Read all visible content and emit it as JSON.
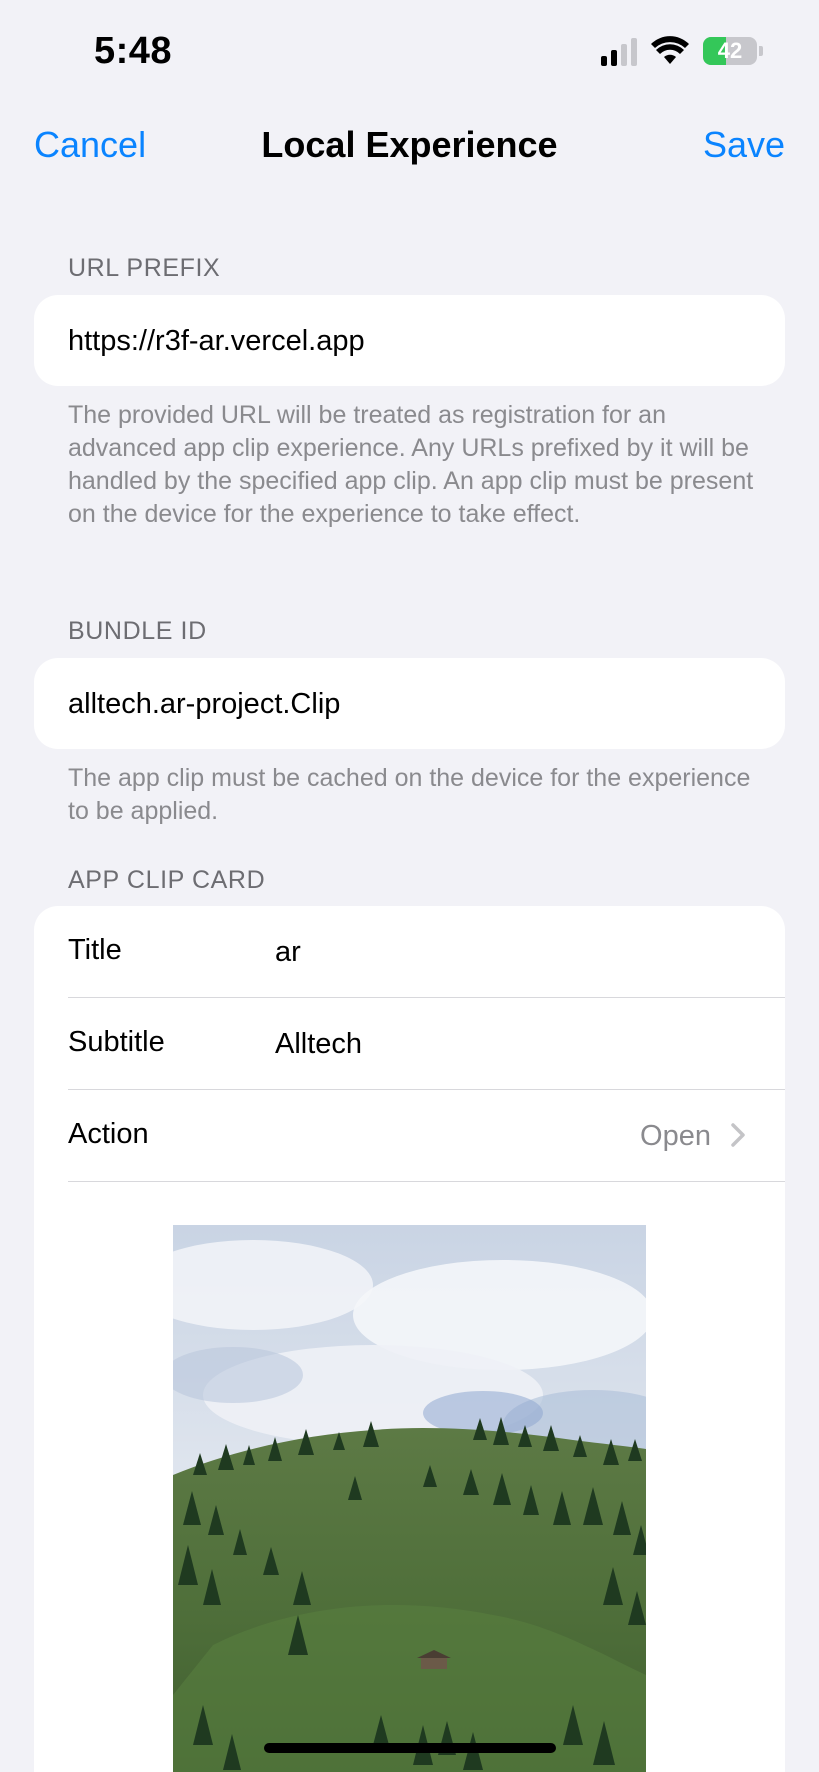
{
  "status_bar": {
    "time": "5:48",
    "battery_percent": "42",
    "battery_level": 0.42,
    "signal_bars_active": 2,
    "icons": [
      "signal-icon",
      "wifi-icon",
      "battery-charging-icon"
    ]
  },
  "nav": {
    "cancel_label": "Cancel",
    "title": "Local Experience",
    "save_label": "Save"
  },
  "url_prefix": {
    "header": "URL PREFIX",
    "value": "https://r3f-ar.vercel.app",
    "footer": "The provided URL will be treated as registration for an advanced app clip experience. Any URLs prefixed by it will be handled by the specified app clip. An app clip must be present on the device for the experience to take effect."
  },
  "bundle_id": {
    "header": "BUNDLE ID",
    "value": "alltech.ar-project.Clip",
    "footer": "The app clip must be cached on the device for the experience to be applied."
  },
  "app_clip_card": {
    "header": "APP CLIP CARD",
    "rows": [
      {
        "label": "Title",
        "value": "ar"
      },
      {
        "label": "Subtitle",
        "value": "Alltech"
      },
      {
        "label": "Action",
        "value": "Open"
      }
    ]
  },
  "colors": {
    "accent": "#0a84ff",
    "background": "#f2f2f7",
    "secondary_text": "#8a8a8e",
    "battery_green": "#34c759"
  }
}
